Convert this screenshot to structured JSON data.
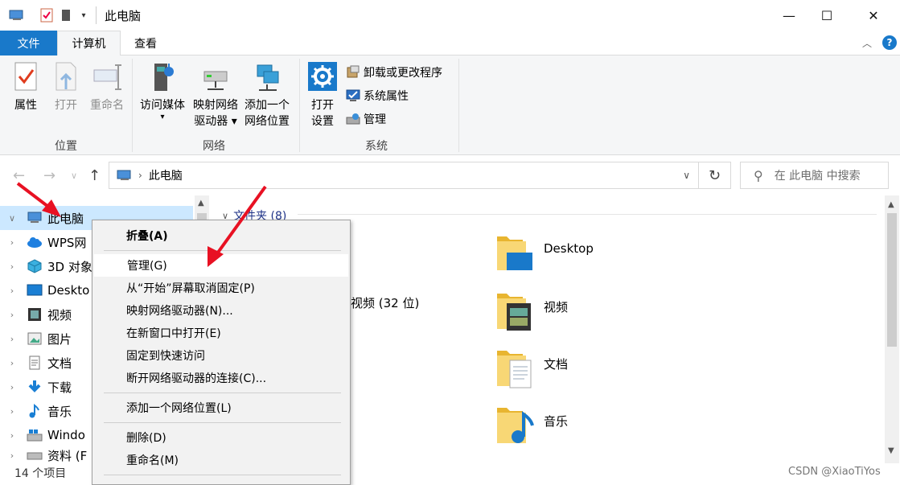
{
  "window": {
    "title": "此电脑",
    "controls": {
      "minimize": "—",
      "maximize": "☐",
      "close": "✕"
    }
  },
  "ribbon_tabs": [
    {
      "label": "文件"
    },
    {
      "label": "计算机"
    },
    {
      "label": "查看"
    }
  ],
  "ribbon": {
    "groups": [
      {
        "label": "位置",
        "buttons": [
          {
            "label": "属性",
            "icon": "properties-icon",
            "enabled": true
          },
          {
            "label": "打开",
            "icon": "open-icon",
            "enabled": false
          },
          {
            "label": "重命名",
            "icon": "rename-icon",
            "enabled": false
          }
        ]
      },
      {
        "label": "网络",
        "buttons": [
          {
            "label_line1": "访问媒体",
            "label_line2": "▾",
            "icon": "media-icon"
          },
          {
            "label_line1": "映射网络",
            "label_line2": "驱动器 ▾",
            "icon": "map-drive-icon"
          },
          {
            "label_line1": "添加一个",
            "label_line2": "网络位置",
            "icon": "network-location-icon"
          }
        ]
      },
      {
        "label": "系统",
        "buttons": [
          {
            "label_line1": "打开",
            "label_line2": "设置",
            "icon": "settings-gear-icon"
          }
        ],
        "small_buttons": [
          {
            "label": "卸载或更改程序",
            "icon": "uninstall-icon"
          },
          {
            "label": "系统属性",
            "icon": "system-properties-icon"
          },
          {
            "label": "管理",
            "icon": "manage-icon"
          }
        ]
      }
    ]
  },
  "address": {
    "path": "此电脑",
    "search_placeholder": "在 此电脑 中搜索"
  },
  "nav_tree": [
    {
      "label": "此电脑",
      "expanded": true,
      "selected": true,
      "icon": "computer-icon"
    },
    {
      "label": "WPS网",
      "icon": "cloud-icon"
    },
    {
      "label": "3D 对象",
      "icon": "3d-objects-icon"
    },
    {
      "label": "Deskto",
      "icon": "desktop-icon"
    },
    {
      "label": "视频",
      "icon": "video-icon"
    },
    {
      "label": "图片",
      "icon": "pictures-icon"
    },
    {
      "label": "文档",
      "icon": "documents-icon"
    },
    {
      "label": "下载",
      "icon": "download-icon"
    },
    {
      "label": "音乐",
      "icon": "music-icon"
    },
    {
      "label": "Windo",
      "icon": "windows-drive-icon"
    },
    {
      "label": "资料 (F",
      "icon": "drive-icon"
    }
  ],
  "main": {
    "section_header": "文件夹 (8)",
    "partial_label": "视频 (32 位)",
    "folders": [
      {
        "label": "Desktop",
        "icon": "desktop-folder-icon"
      },
      {
        "label": "视频",
        "icon": "video-folder-icon"
      },
      {
        "label": "文档",
        "icon": "documents-folder-icon"
      },
      {
        "label": "音乐",
        "icon": "music-folder-icon"
      }
    ]
  },
  "context_menu": {
    "items": [
      {
        "label": "折叠(A)",
        "bold": true
      },
      {
        "label": "管理(G)",
        "hover": true
      },
      {
        "label": "从“开始”屏幕取消固定(P)"
      },
      {
        "label": "映射网络驱动器(N)..."
      },
      {
        "label": "在新窗口中打开(E)"
      },
      {
        "label": "固定到快速访问"
      },
      {
        "label": "断开网络驱动器的连接(C)..."
      },
      {
        "label": "添加一个网络位置(L)"
      },
      {
        "label": "删除(D)"
      },
      {
        "label": "重命名(M)"
      }
    ]
  },
  "status": {
    "item_count": "14 个项目"
  },
  "watermark": "CSDN @XiaoTiYos",
  "colors": {
    "accent": "#1979ca",
    "selection": "#cce8ff",
    "annotation": "#e81123"
  }
}
